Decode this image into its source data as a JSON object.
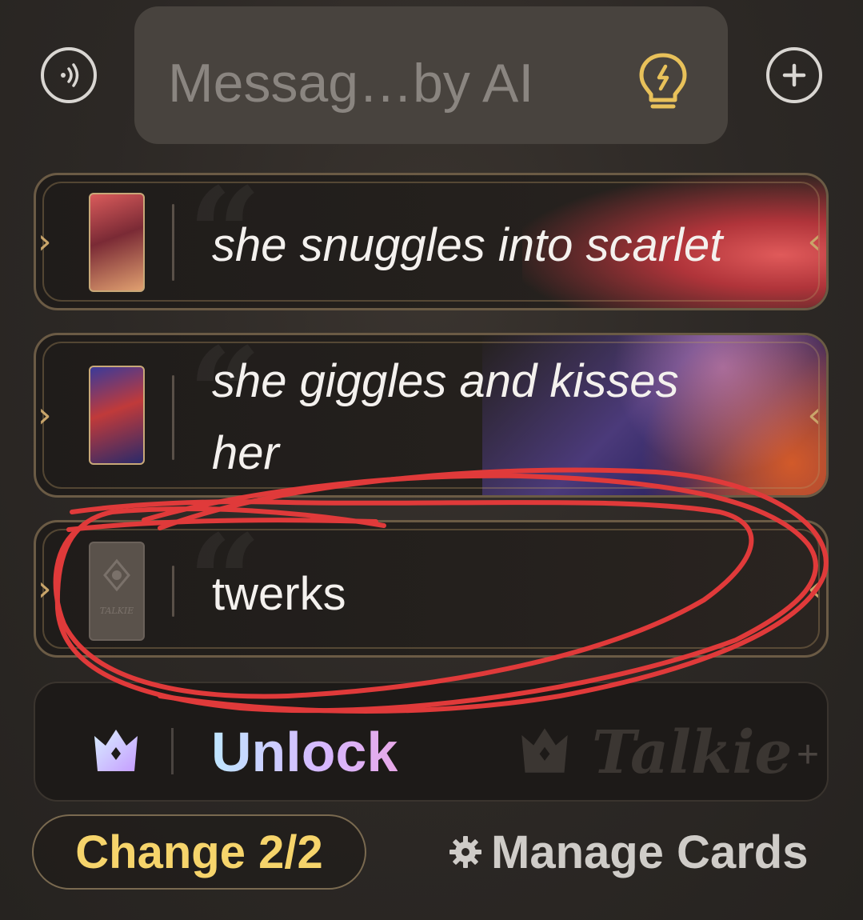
{
  "composer": {
    "placeholder": "Messag…by AI",
    "voice_icon": "voice-waves-icon",
    "hint_icon": "lightbulb-icon",
    "add_icon": "plus-circle-icon"
  },
  "cards": [
    {
      "text": "she snuggles into scarlet",
      "style": "italic"
    },
    {
      "text_lines": [
        "she giggles and kisses",
        "her"
      ],
      "style": "italic"
    },
    {
      "text": "twerks",
      "style": "normal",
      "thumb_label": "TALKIE"
    }
  ],
  "unlock": {
    "label": "Unlock",
    "brand": "Talkie",
    "brand_plus": "+"
  },
  "footer": {
    "change_label": "Change 2/2",
    "manage_label": "Manage Cards"
  },
  "colors": {
    "accent_gold": "#f6d46b",
    "annotation_red": "#e03a3a",
    "hint_yellow": "#e8c15a"
  }
}
